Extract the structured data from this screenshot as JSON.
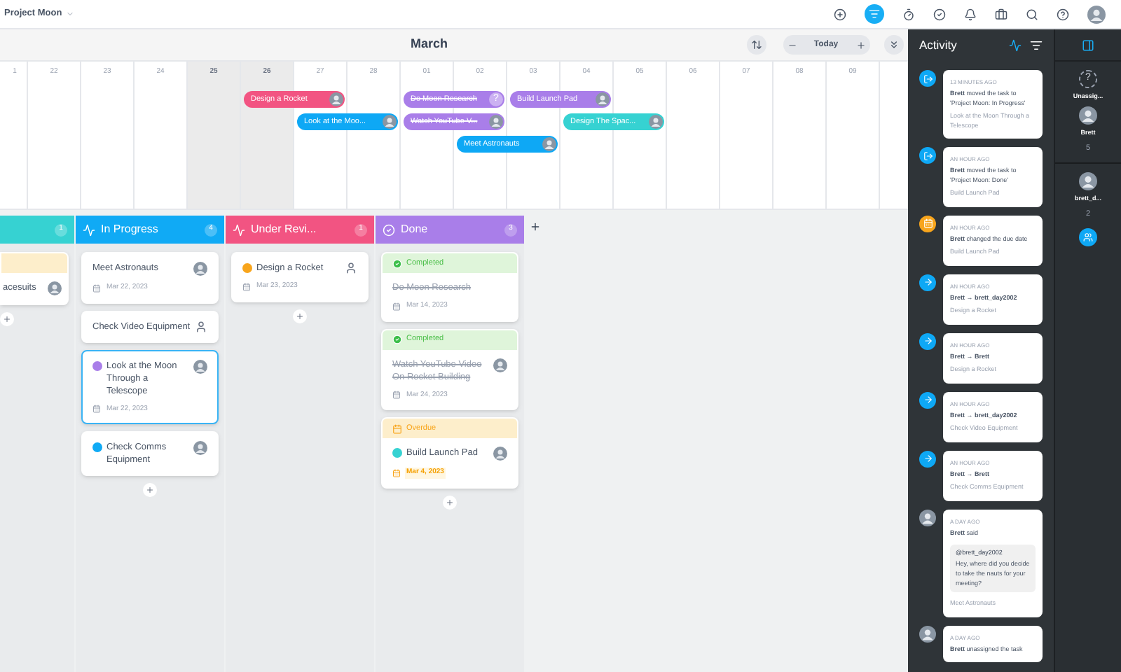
{
  "topbar": {
    "project": "Project Moon"
  },
  "timeline": {
    "month": "March",
    "today_label": "Today",
    "days": [
      {
        "label": "1",
        "weekend": false
      },
      {
        "label": "22",
        "weekend": false
      },
      {
        "label": "23",
        "weekend": false
      },
      {
        "label": "24",
        "weekend": false
      },
      {
        "label": "25",
        "weekend": true
      },
      {
        "label": "26",
        "weekend": true
      },
      {
        "label": "27",
        "weekend": false
      },
      {
        "label": "28",
        "weekend": false
      },
      {
        "label": "01",
        "weekend": false
      },
      {
        "label": "02",
        "weekend": false
      },
      {
        "label": "03",
        "weekend": false
      },
      {
        "label": "04",
        "weekend": false
      },
      {
        "label": "05",
        "weekend": false
      },
      {
        "label": "06",
        "weekend": false
      },
      {
        "label": "07",
        "weekend": false
      },
      {
        "label": "08",
        "weekend": false
      },
      {
        "label": "09",
        "weekend": false
      }
    ],
    "lanes": [
      [
        {
          "kind": "gap"
        },
        {
          "kind": "gap"
        },
        {
          "kind": "gap"
        },
        {
          "kind": "gap"
        },
        {
          "kind": "gap"
        },
        {
          "kind": "bar",
          "label": "Design a Rocket",
          "color": "#f25482",
          "done": false
        },
        {
          "kind": "gap"
        },
        {
          "kind": "bar",
          "label": "Do Moon Research",
          "color": "#a97ee9",
          "done": true,
          "unassigned_mark": "?"
        },
        {
          "kind": "bar",
          "label": "Build Launch Pad",
          "color": "#a97ee9",
          "done": false
        }
      ],
      [
        {
          "kind": "gap"
        },
        {
          "kind": "gap"
        },
        {
          "kind": "gap"
        },
        {
          "kind": "gap"
        },
        {
          "kind": "gap"
        },
        {
          "kind": "gap"
        },
        {
          "kind": "bar",
          "label": "Look at the Moo...",
          "color": "#0ea8f5",
          "done": false
        },
        {
          "kind": "bar",
          "label": "Watch YouTube V...",
          "color": "#a97ee9",
          "done": true
        },
        {
          "kind": "gap"
        },
        {
          "kind": "bar",
          "label": "Design The Spac...",
          "color": "#36d2d2",
          "done": false
        }
      ],
      [
        {
          "kind": "gap"
        },
        {
          "kind": "gap"
        },
        {
          "kind": "gap"
        },
        {
          "kind": "gap"
        },
        {
          "kind": "gap"
        },
        {
          "kind": "gap"
        },
        {
          "kind": "gap"
        },
        {
          "kind": "gap"
        },
        {
          "kind": "gap"
        },
        {
          "kind": "bar",
          "label": "Meet Astronauts",
          "color": "#0ea8f5",
          "done": false
        }
      ]
    ]
  },
  "board": {
    "columns": [
      {
        "kind": "open",
        "count": "1",
        "color": "#36d2d2",
        "partial": true,
        "cards": [
          {
            "title": "acesuits",
            "status": {
              "kind": "overdue"
            },
            "assigned": true,
            "done": false,
            "selected": false
          }
        ]
      },
      {
        "kind": "working",
        "title": "In Progress",
        "count": "4",
        "color": "#10aaf5",
        "partial": false,
        "cards": [
          {
            "title": "Meet Astronauts",
            "assigned": true,
            "date": "Mar 22, 2023",
            "overdue": false,
            "done": false,
            "selected": false
          },
          {
            "title": "Check Video Equipment",
            "assigned": false,
            "done": false,
            "selected": false
          },
          {
            "title": "Look at the Moon Through a Telescope",
            "color": "#a97ee9",
            "assigned": true,
            "date": "Mar 22, 2023",
            "overdue": false,
            "done": false,
            "selected": true
          },
          {
            "title": "Check Comms Equipment",
            "color": "#10aaf5",
            "assigned": true,
            "done": false,
            "selected": false
          }
        ]
      },
      {
        "kind": "review",
        "title": "Under Revi...",
        "count": "1",
        "color": "#f25482",
        "partial": false,
        "cards": [
          {
            "title": "Design a Rocket",
            "color": "#f8a51c",
            "assigned": false,
            "date": "Mar 23, 2023",
            "overdue": false,
            "done": false,
            "selected": false
          }
        ]
      },
      {
        "kind": "done",
        "title": "Done",
        "count": "3",
        "color": "#a97ee9",
        "partial": false,
        "cards": [
          {
            "title": "Do Moon Research",
            "status": {
              "kind": "completed",
              "label": "Completed"
            },
            "date": "Mar 14, 2023",
            "overdue": false,
            "done": true,
            "selected": false
          },
          {
            "title": "Watch YouTube Video On Rocket Building",
            "status": {
              "kind": "completed",
              "label": "Completed"
            },
            "assigned": true,
            "date": "Mar 24, 2023",
            "overdue": false,
            "done": true,
            "selected": false
          },
          {
            "title": "Build Launch Pad",
            "status": {
              "kind": "overdue",
              "label": "Overdue"
            },
            "color": "#36d2d2",
            "assigned": true,
            "date": "Mar 4, 2023",
            "overdue": true,
            "done": false,
            "selected": false
          }
        ]
      }
    ]
  },
  "activity": {
    "title": "Activity",
    "items": [
      {
        "kind": "move",
        "time": "13 MINUTES AGO",
        "text": "**Brett** moved the task to 'Project Moon: In Progress'",
        "task": "Look at the Moon Through a Telescope"
      },
      {
        "kind": "move",
        "time": "AN HOUR AGO",
        "text": "**Brett** moved the task to 'Project Moon: Done'",
        "task": "Build Launch Pad"
      },
      {
        "kind": "date",
        "time": "AN HOUR AGO",
        "text": "**Brett** changed the due date",
        "task": "Build Launch Pad"
      },
      {
        "kind": "assign",
        "time": "AN HOUR AGO",
        "text": "**Brett** → **brett_day2002**",
        "task": "Design a Rocket"
      },
      {
        "kind": "assign",
        "time": "AN HOUR AGO",
        "text": "**Brett** → **Brett**",
        "task": "Design a Rocket"
      },
      {
        "kind": "assign",
        "time": "AN HOUR AGO",
        "text": "**Brett** → **brett_day2002**",
        "task": "Check Video Equipment"
      },
      {
        "kind": "assign",
        "time": "AN HOUR AGO",
        "text": "**Brett** → **Brett**",
        "task": "Check Comms Equipment"
      },
      {
        "kind": "comment",
        "time": "A DAY AGO",
        "text": "**Brett** said",
        "quote": {
          "mention": "@brett_day2002",
          "body": "Hey, where did you decide to take the nauts for your meeting?"
        },
        "task": "Meet Astronauts"
      },
      {
        "kind": "comment",
        "time": "A DAY AGO",
        "text": "**Brett** unassigned the task"
      }
    ]
  },
  "people": [
    {
      "kind": "unknown",
      "mark": "?",
      "name": "Unassig..."
    },
    {
      "kind": "avatar",
      "name": "Brett",
      "count": "5"
    },
    {
      "kind": "avatar",
      "name": "brett_d...",
      "count": "2"
    }
  ]
}
